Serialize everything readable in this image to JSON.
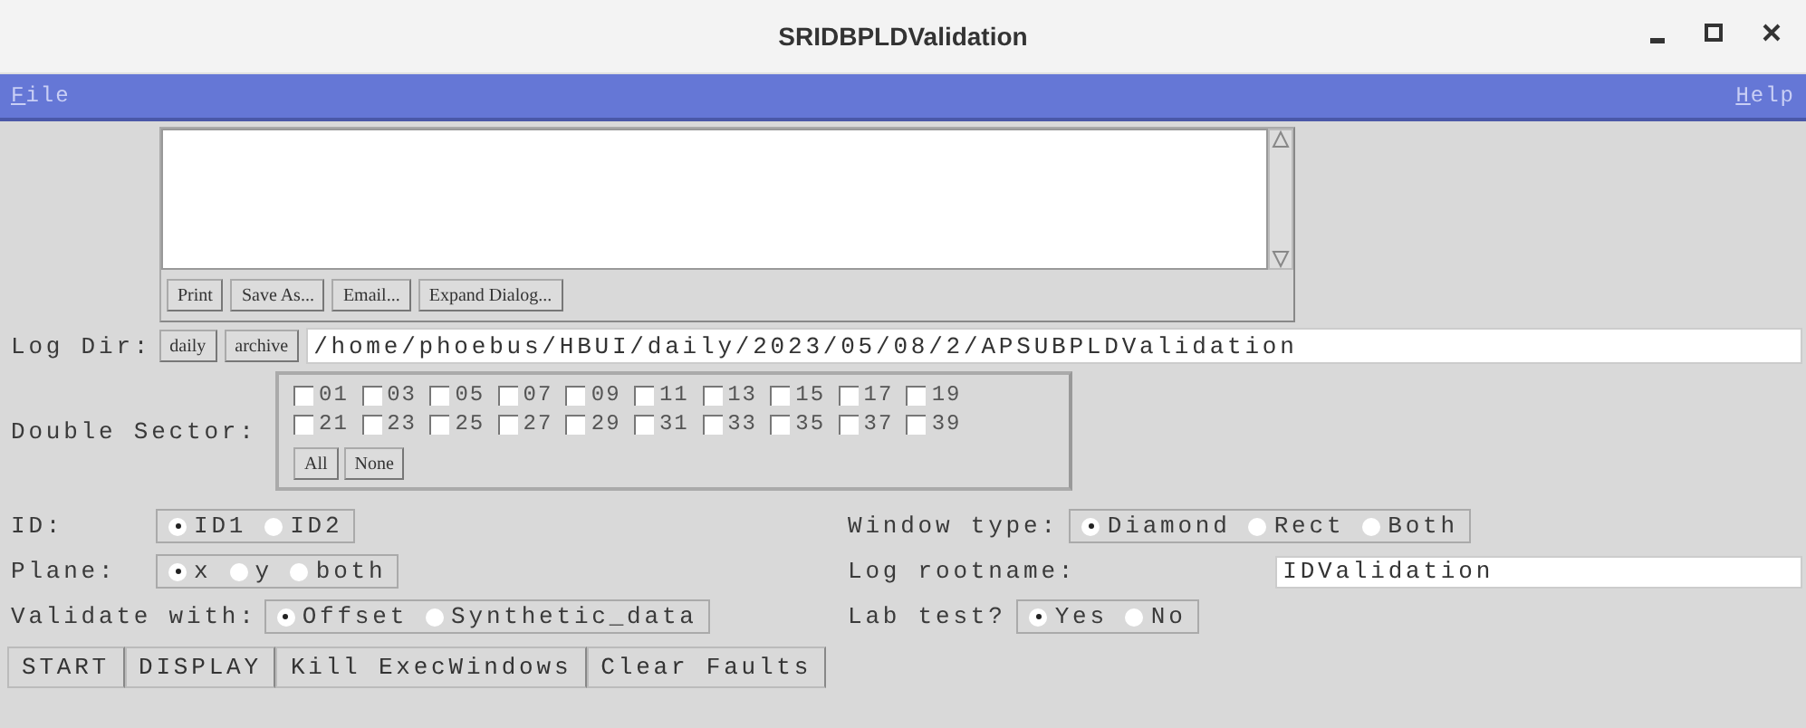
{
  "window": {
    "title": "SRIDBPLDValidation"
  },
  "menu": [
    {
      "label": "File"
    },
    {
      "label": "Help"
    }
  ],
  "log": {
    "buttons": [
      "Print",
      "Save As...",
      "Email...",
      "Expand Dialog..."
    ]
  },
  "log_dir": {
    "label": "Log Dir:",
    "buttons": [
      "daily",
      "archive"
    ],
    "value": "/home/phoebus/HBUI/daily/2023/05/08/2/APSUBPLDValidation"
  },
  "double_sector": {
    "label": "Double Sector:",
    "sectors": [
      {
        "label": "01",
        "checked": false
      },
      {
        "label": "03",
        "checked": false
      },
      {
        "label": "05",
        "checked": false
      },
      {
        "label": "07",
        "checked": false
      },
      {
        "label": "09",
        "checked": false
      },
      {
        "label": "11",
        "checked": false
      },
      {
        "label": "13",
        "checked": false
      },
      {
        "label": "15",
        "checked": false
      },
      {
        "label": "17",
        "checked": false
      },
      {
        "label": "19",
        "checked": false
      },
      {
        "label": "21",
        "checked": false
      },
      {
        "label": "23",
        "checked": false
      },
      {
        "label": "25",
        "checked": false
      },
      {
        "label": "27",
        "checked": false
      },
      {
        "label": "29",
        "checked": false
      },
      {
        "label": "31",
        "checked": false
      },
      {
        "label": "33",
        "checked": false
      },
      {
        "label": "35",
        "checked": false
      },
      {
        "label": "37",
        "checked": false
      },
      {
        "label": "39",
        "checked": false
      }
    ],
    "buttons": [
      "All",
      "None"
    ]
  },
  "left_rows": [
    {
      "kind": "radio",
      "label": "ID:",
      "options": [
        {
          "label": "ID1",
          "selected": true
        },
        {
          "label": "ID2",
          "selected": false
        }
      ]
    },
    {
      "kind": "radio",
      "label": "Plane:",
      "options": [
        {
          "label": "x",
          "selected": true
        },
        {
          "label": "y",
          "selected": false
        },
        {
          "label": "both",
          "selected": false
        }
      ]
    },
    {
      "kind": "radio",
      "label": "Validate with:",
      "options": [
        {
          "label": "Offset",
          "selected": true
        },
        {
          "label": "Synthetic_data",
          "selected": false
        }
      ]
    }
  ],
  "right_rows": [
    {
      "kind": "radio",
      "label": "Window type:",
      "options": [
        {
          "label": "Diamond",
          "selected": true
        },
        {
          "label": "Rect",
          "selected": false
        },
        {
          "label": "Both",
          "selected": false
        }
      ]
    },
    {
      "kind": "field",
      "label": "Log rootname:",
      "value": "IDValidation"
    },
    {
      "kind": "radio",
      "label": "Lab test?",
      "options": [
        {
          "label": "Yes",
          "selected": true
        },
        {
          "label": "No",
          "selected": false
        }
      ]
    }
  ],
  "actions": [
    "START",
    "DISPLAY",
    "Kill ExecWindows",
    "Clear Faults"
  ]
}
